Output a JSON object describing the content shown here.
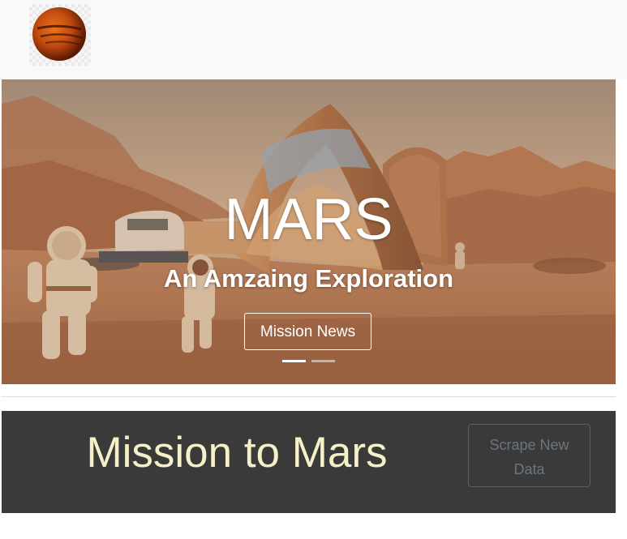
{
  "navbar": {
    "logo_icon": "mars-planet-icon"
  },
  "hero": {
    "title": "MARS",
    "subtitle": "An Amzaing Exploration",
    "button_label": "Mission News",
    "slide_count": 2,
    "active_slide": 1
  },
  "banner": {
    "heading": "Mission to Mars",
    "button_label": "Scrape New Data"
  },
  "colors": {
    "navbar_bg": "#f8f9fa",
    "banner_bg": "#3a3a3a",
    "heading_text": "#f5f0c8",
    "muted_button_text": "#6c757d"
  }
}
